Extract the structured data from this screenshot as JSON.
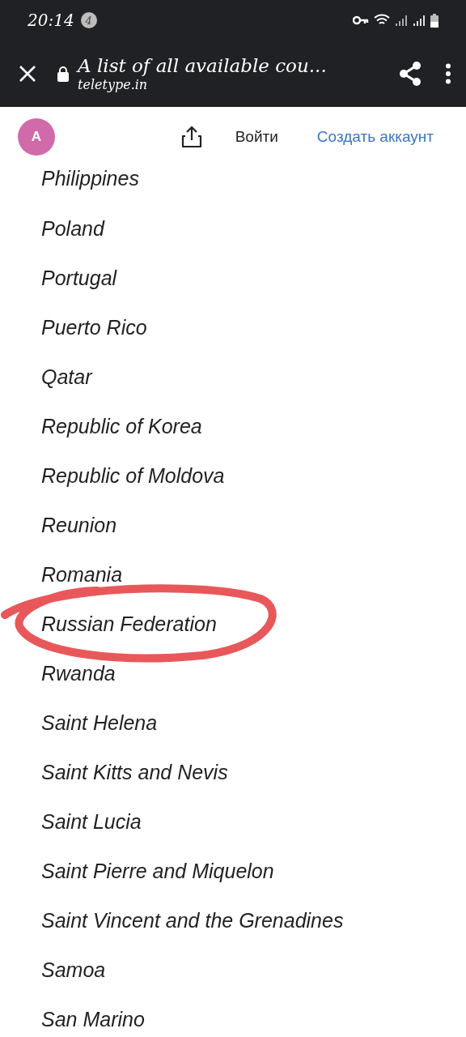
{
  "status_bar": {
    "time": "20:14",
    "notification_count": "4"
  },
  "browser_bar": {
    "title": "A list of all available cou...",
    "domain": "teletype.in"
  },
  "site_header": {
    "avatar_letter": "A",
    "login": "Войти",
    "signup": "Создать аккаунт"
  },
  "countries": [
    {
      "name": "Philippines",
      "circled": false
    },
    {
      "name": "Poland",
      "circled": false
    },
    {
      "name": "Portugal",
      "circled": false
    },
    {
      "name": "Puerto Rico",
      "circled": false
    },
    {
      "name": "Qatar",
      "circled": false
    },
    {
      "name": "Republic of Korea",
      "circled": false
    },
    {
      "name": "Republic of Moldova",
      "circled": false
    },
    {
      "name": "Reunion",
      "circled": false
    },
    {
      "name": "Romania",
      "circled": false
    },
    {
      "name": "Russian Federation",
      "circled": true
    },
    {
      "name": "Rwanda",
      "circled": false
    },
    {
      "name": "Saint Helena",
      "circled": false
    },
    {
      "name": "Saint Kitts and Nevis",
      "circled": false
    },
    {
      "name": "Saint Lucia",
      "circled": false
    },
    {
      "name": "Saint Pierre and Miquelon",
      "circled": false
    },
    {
      "name": "Saint Vincent and the Grenadines",
      "circled": false
    },
    {
      "name": "Samoa",
      "circled": false
    },
    {
      "name": "San Marino",
      "circled": false
    }
  ]
}
